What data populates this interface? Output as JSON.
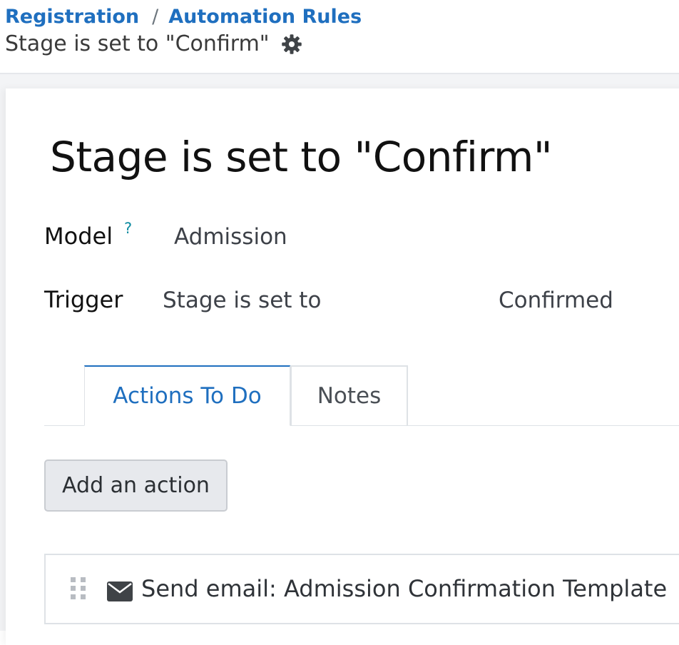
{
  "breadcrumb": {
    "items": [
      "Registration",
      "Automation Rules"
    ],
    "separator": "/"
  },
  "record": {
    "name": "Stage is set to \"Confirm\""
  },
  "form": {
    "title": "Stage is set to \"Confirm\"",
    "model": {
      "label": "Model",
      "help": "?",
      "value": "Admission"
    },
    "trigger": {
      "label": "Trigger",
      "value": "Stage is set to",
      "stage": "Confirmed"
    }
  },
  "tabs": [
    {
      "label": "Actions To Do",
      "active": true
    },
    {
      "label": "Notes",
      "active": false
    }
  ],
  "actions": {
    "add_label": "Add an action",
    "items": [
      {
        "label": "Send email: Admission Confirmation Template",
        "icon": "envelope-icon"
      }
    ]
  },
  "colors": {
    "link": "#1f6fbf",
    "help": "#0d8ba0"
  }
}
